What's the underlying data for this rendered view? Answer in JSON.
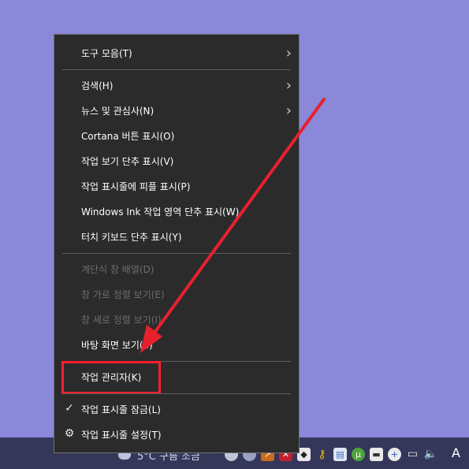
{
  "context_menu": {
    "items": [
      {
        "label": "도구 모음(T)",
        "submenu": true,
        "enabled": true
      },
      {
        "label": "검색(H)",
        "submenu": true,
        "enabled": true
      },
      {
        "label": "뉴스 및 관심사(N)",
        "submenu": true,
        "enabled": true
      },
      {
        "label": "Cortana 버튼 표시(O)",
        "submenu": false,
        "enabled": true
      },
      {
        "label": "작업 보기 단추 표시(V)",
        "submenu": false,
        "enabled": true
      },
      {
        "label": "작업 표시줄에 피플 표시(P)",
        "submenu": false,
        "enabled": true
      },
      {
        "label": "Windows Ink 작업 영역 단추 표시(W)",
        "submenu": false,
        "enabled": true
      },
      {
        "label": "터치 키보드 단추 표시(Y)",
        "submenu": false,
        "enabled": true
      },
      {
        "label": "계단식 창 배열(D)",
        "submenu": false,
        "enabled": false
      },
      {
        "label": "창 가로 정렬 보기(E)",
        "submenu": false,
        "enabled": false
      },
      {
        "label": "창 세로 정렬 보기(I)",
        "submenu": false,
        "enabled": false
      },
      {
        "label": "바탕 화면 보기(S)",
        "submenu": false,
        "enabled": true
      },
      {
        "label": "작업 관리자(K)",
        "submenu": false,
        "enabled": true
      },
      {
        "label": "작업 표시줄 잠금(L)",
        "submenu": false,
        "enabled": true,
        "checked": true
      },
      {
        "label": "작업 표시줄 설정(T)",
        "submenu": false,
        "enabled": true,
        "icon": "gear-icon"
      }
    ]
  },
  "taskbar": {
    "weather_text": "5°C 구름 조금",
    "language_indicator": "A",
    "tray_icons": [
      "weather-icon",
      "chat-icon",
      "network-activity-icon",
      "app-icon",
      "app-icon",
      "shield-icon",
      "key-icon",
      "document-icon",
      "torrent-icon",
      "message-icon",
      "plus-icon",
      "network-icon",
      "volume-icon"
    ]
  },
  "annotations": {
    "highlight_color": "#ff1f2d",
    "arrow_color": "#e8202e"
  },
  "colors": {
    "desktop": "#8b87d9",
    "menu_bg": "#2b2b2b",
    "menu_text": "#ffffff",
    "menu_disabled_text": "#6d6d6d",
    "taskbar_bg": "#34375a"
  }
}
